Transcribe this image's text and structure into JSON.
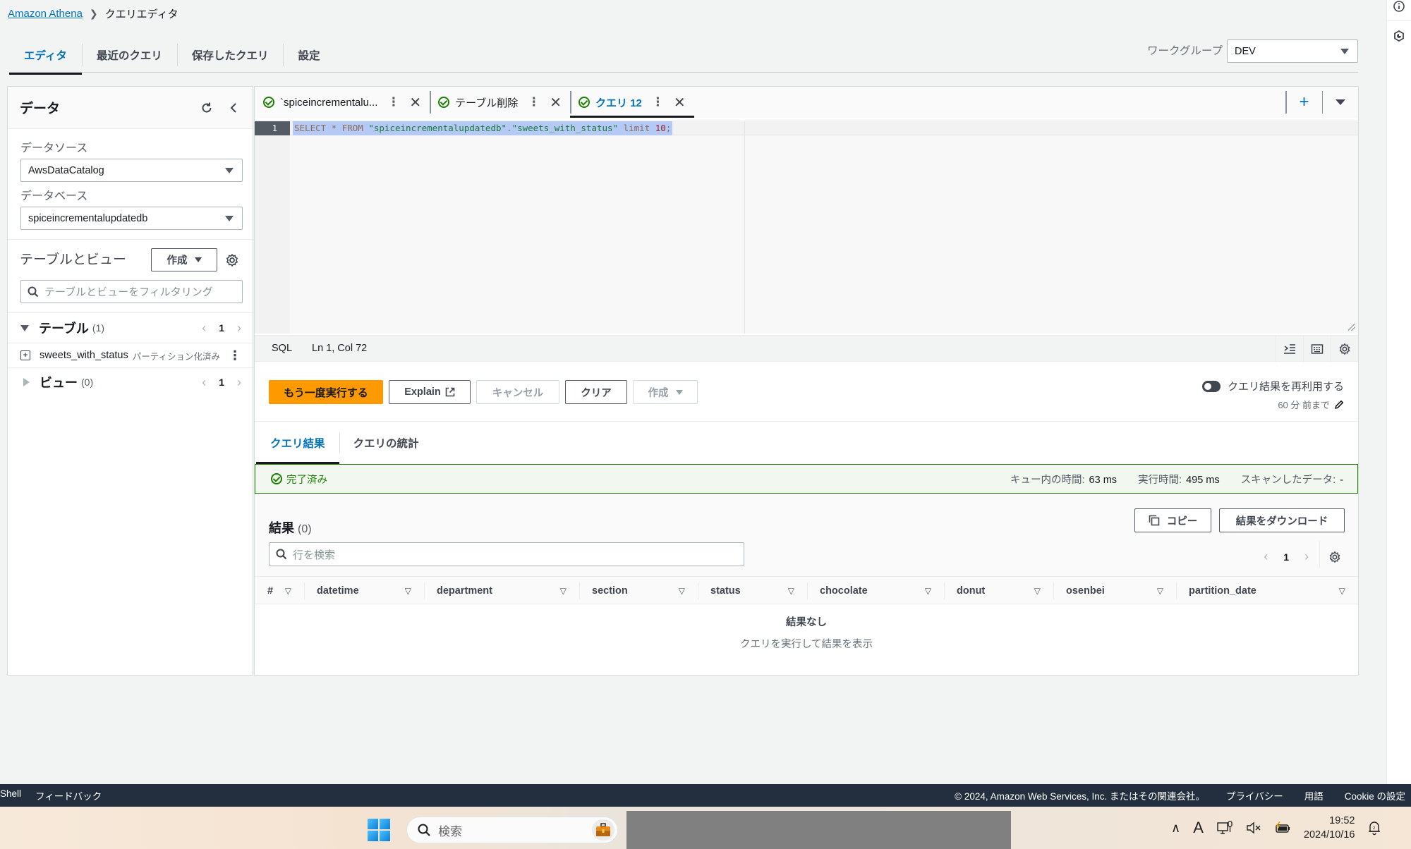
{
  "breadcrumb": {
    "root": "Amazon Athena",
    "current": "クエリエディタ"
  },
  "top_tabs": [
    {
      "label": "エディタ",
      "active": true
    },
    {
      "label": "最近のクエリ",
      "active": false
    },
    {
      "label": "保存したクエリ",
      "active": false
    },
    {
      "label": "設定",
      "active": false
    }
  ],
  "workgroup": {
    "label": "ワークグループ",
    "value": "DEV"
  },
  "right_strip": {
    "icons": [
      "info-icon",
      "feedback-icon"
    ]
  },
  "data_panel": {
    "title": "データ",
    "datasource_label": "データソース",
    "datasource_value": "AwsDataCatalog",
    "database_label": "データベース",
    "database_value": "spiceincrementalupdatedb",
    "tables_views_title": "テーブルとビュー",
    "create_label": "作成",
    "filter_placeholder": "テーブルとビューをフィルタリング",
    "tables_section": {
      "title": "テーブル",
      "count": "(1)",
      "page": "1"
    },
    "table_items": [
      {
        "name": "sweets_with_status",
        "badge": "パーティション化済み"
      }
    ],
    "views_section": {
      "title": "ビュー",
      "count": "(0)",
      "page": "1"
    }
  },
  "query_tabs": [
    {
      "label": "`spiceincrementalu...",
      "active": false
    },
    {
      "label": "テーブル削除",
      "active": false
    },
    {
      "label": "クエリ 12",
      "active": true
    }
  ],
  "editor": {
    "line_number": "1",
    "tokens": [
      {
        "t": "kw",
        "v": "SELECT * FROM "
      },
      {
        "t": "str",
        "v": "\"spiceincrementalupdatedb\""
      },
      {
        "t": "kw",
        "v": "."
      },
      {
        "t": "str",
        "v": "\"sweets_with_status\""
      },
      {
        "t": "kw",
        "v": " limit "
      },
      {
        "t": "num",
        "v": "10"
      },
      {
        "t": "kw",
        "v": ";"
      }
    ]
  },
  "statusbar": {
    "language": "SQL",
    "cursor": "Ln 1, Col 72"
  },
  "actions": {
    "run_again": "もう一度実行する",
    "explain": "Explain",
    "cancel": "キャンセル",
    "clear": "クリア",
    "create": "作成"
  },
  "reuse": {
    "label": "クエリ結果を再利用する",
    "sub": "60 分 前まで",
    "enabled": false
  },
  "result_tabs": [
    {
      "label": "クエリ結果",
      "active": true
    },
    {
      "label": "クエリの統計",
      "active": false
    }
  ],
  "status": {
    "text": "完了済み",
    "queue_label": "キュー内の時間:",
    "queue_value": "63 ms",
    "exec_label": "実行時間:",
    "exec_value": "495 ms",
    "scan_label": "スキャンしたデータ:",
    "scan_value": "-",
    "color": "#1d8102"
  },
  "results": {
    "title": "結果",
    "count": "(0)",
    "copy_label": "コピー",
    "download_label": "結果をダウンロード",
    "search_placeholder": "行を検索",
    "page": "1",
    "columns": [
      "#",
      "datetime",
      "department",
      "section",
      "status",
      "chocolate",
      "donut",
      "osenbei",
      "partition_date"
    ],
    "empty_title": "結果なし",
    "empty_sub": "クエリを実行して結果を表示"
  },
  "footer": {
    "left": [
      "Shell",
      "フィードバック"
    ],
    "copyright": "© 2024, Amazon Web Services, Inc. またはその関連会社。",
    "links": [
      "プライバシー",
      "用語",
      "Cookie の設定"
    ]
  },
  "taskbar": {
    "search_placeholder": "検索",
    "time": "19:52",
    "date": "2024/10/16",
    "ime": "A"
  },
  "colors": {
    "accent": "#0073bb",
    "primary_button": "#ff9900",
    "success": "#1d8102",
    "footer_bg": "#232f3e"
  }
}
